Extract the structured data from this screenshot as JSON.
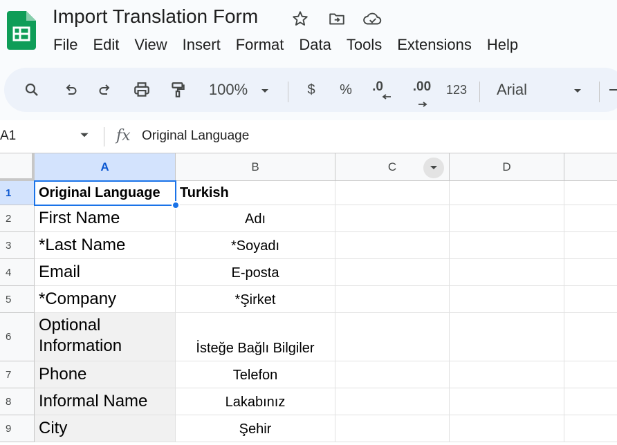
{
  "app": {
    "doc_title": "Import Translation Form",
    "menu": [
      "File",
      "Edit",
      "View",
      "Insert",
      "Format",
      "Data",
      "Tools",
      "Extensions",
      "Help"
    ],
    "brand_color": "#0f9d58"
  },
  "toolbar": {
    "zoom": "100%",
    "currency": "$",
    "percent": "%",
    "decrease_decimal": ".0",
    "increase_decimal": ".00",
    "number_format": "123",
    "font": "Arial"
  },
  "formula_bar": {
    "cell_ref": "A1",
    "fx": "fx",
    "value": "Original Language"
  },
  "sheet": {
    "columns": [
      "A",
      "B",
      "C",
      "D"
    ],
    "rows": [
      {
        "num": "1",
        "a": "Original Language",
        "b": "Turkish"
      },
      {
        "num": "2",
        "a": "First Name",
        "b": "Adı"
      },
      {
        "num": "3",
        "a": "*Last Name",
        "b": "*Soyadı"
      },
      {
        "num": "4",
        "a": "Email",
        "b": "E-posta"
      },
      {
        "num": "5",
        "a": "*Company",
        "b": "*Şirket"
      },
      {
        "num": "6",
        "a": "Optional Information",
        "b": "İsteğe Bağlı Bilgiler"
      },
      {
        "num": "7",
        "a": "Phone",
        "b": "Telefon"
      },
      {
        "num": "8",
        "a": "Informal Name",
        "b": "Lakabınız"
      },
      {
        "num": "9",
        "a": "City",
        "b": "Şehir"
      }
    ],
    "selected_cell": "A1",
    "selection_color": "#1a73e8"
  }
}
